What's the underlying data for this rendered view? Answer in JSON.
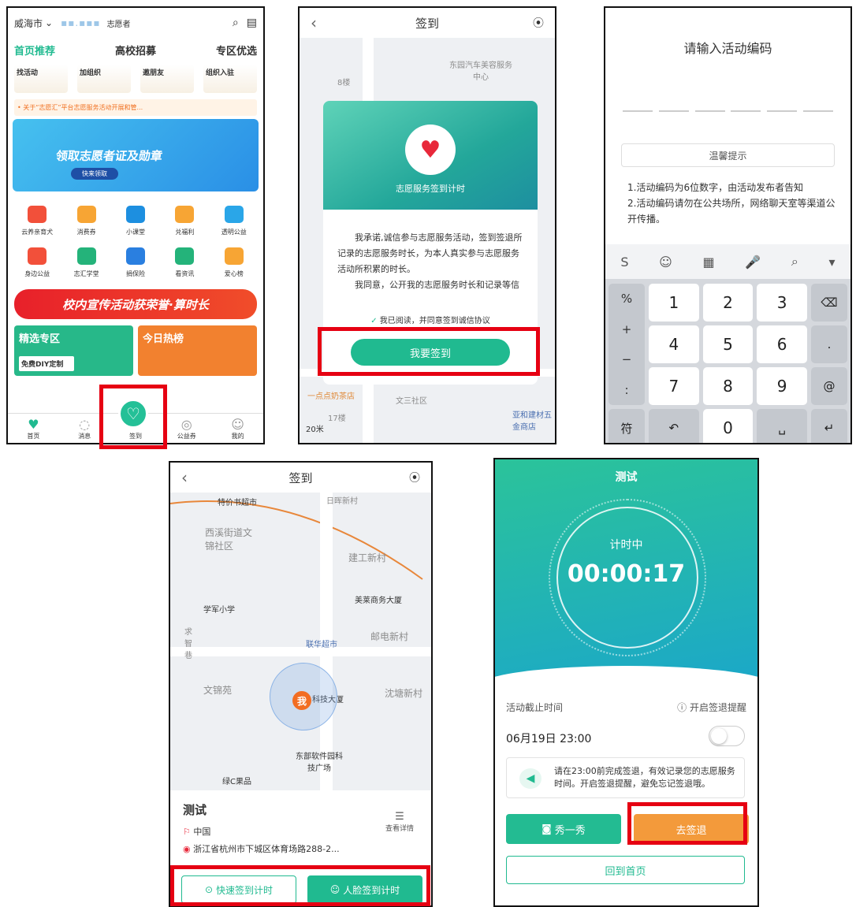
{
  "screen1": {
    "city": "威海市",
    "role": "志愿者",
    "tabs": [
      "首页推荐",
      "高校招募",
      "专区优选"
    ],
    "chips": [
      "找活动",
      "加组织",
      "邀朋友",
      "组织入驻"
    ],
    "notice": "• 关于“志愿汇”平台志愿服务活动开展和管...",
    "banner_title": "领取志愿者证及勋章",
    "banner_button": "快来领取",
    "grid": [
      {
        "label": "云养亲育犬",
        "color": "#f2503a"
      },
      {
        "label": "消费券",
        "color": "#f7a534"
      },
      {
        "label": "小课堂",
        "color": "#1d8fe0"
      },
      {
        "label": "兑福利",
        "color": "#f7a534"
      },
      {
        "label": "透明公益",
        "color": "#2aa6e8"
      },
      {
        "label": "身边公益",
        "color": "#f2503a"
      },
      {
        "label": "志汇学堂",
        "color": "#24b37a"
      },
      {
        "label": "捐保险",
        "color": "#2a7fe0"
      },
      {
        "label": "看资讯",
        "color": "#24b37a"
      },
      {
        "label": "爱心榜",
        "color": "#f7a534"
      }
    ],
    "campus_banner": "校内宣传活动获荣誉·算时长",
    "sections": [
      "精选专区",
      "今日热榜"
    ],
    "diy": "免费DIY定制",
    "nav": [
      "首页",
      "消息",
      "签到",
      "公益券",
      "我的"
    ]
  },
  "screen2": {
    "title": "签到",
    "map_labels": [
      "东园汽车美容服务中心",
      "8楼",
      "一点点奶茶店",
      "文三社区",
      "17楼",
      "亚和建材五金商店",
      "20米"
    ],
    "card_caption": "志愿服务签到计时",
    "paragraph1": "我承诺,诚信参与志愿服务活动，签到签退所记录的志愿服务时长，为本人真实参与志愿服务活动所积累的时长。",
    "paragraph2": "我同意，公开我的志愿服务时长和记录等信息，以积合广大志愿者和志愿汇对诚",
    "agree": "我已阅读，并同意签到诚信协议",
    "button": "我要签到"
  },
  "screen3": {
    "title": "请输入活动编码",
    "tip_title": "温馨提示",
    "rule1": "1.活动编码为6位数字，由活动发布者告知",
    "rule2": "2.活动编码请勿在公共场所，网络聊天室等渠道公开传播。",
    "side_keys": [
      "%",
      "+",
      "−",
      ":"
    ],
    "keys": [
      "1",
      "2",
      "3",
      "4",
      "5",
      "6",
      "7",
      "8",
      "9"
    ],
    "right_keys": [
      "⌫",
      ".",
      "@"
    ],
    "bottom_keys": [
      "符",
      "↶",
      "0",
      "␣",
      "↵"
    ],
    "toolbar": [
      "S",
      "☺",
      "▦",
      "🎤",
      "⌕",
      "▾"
    ]
  },
  "screen4": {
    "title": "签到",
    "map_labels": [
      "特价书超市",
      "日晖新村",
      "西溪街道文锦社区",
      "建工新村",
      "学军小学",
      "美莱商务大厦",
      "求智巷",
      "联华超市",
      "邮电新村",
      "文锦苑",
      "科技大厦",
      "沈塘新村",
      "东部软件园科技广场",
      "绿C果品"
    ],
    "me": "我",
    "activity_name": "测试",
    "view_detail": "查看详情",
    "country": "中国",
    "address": "浙江省杭州市下城区体育场路288-2...",
    "quick_button": "快速签到计时",
    "face_button": "人脸签到计时"
  },
  "screen5": {
    "title": "测试",
    "status": "计时中",
    "time": "00:00:17",
    "deadline_label": "活动截止时间",
    "remind_label": "开启签退提醒",
    "deadline_value": "06月19日 23:00",
    "note": "请在23:00前完成签退，有效记录您的志愿服务时间。开启签退提醒，避免忘记签退哦。",
    "show_button": "秀一秀",
    "signout_button": "去签退",
    "home_button": "回到首页"
  },
  "colors": {
    "brand_green": "#20ba90",
    "highlight_red": "#e60012",
    "orange": "#f39a3b"
  }
}
